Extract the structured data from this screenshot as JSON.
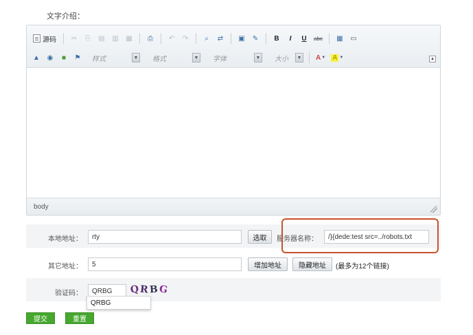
{
  "section": {
    "label": "文字介绍："
  },
  "toolbar": {
    "source_label": "源码",
    "style_combo": "样式",
    "format_combo": "格式",
    "font_combo": "字体",
    "size_combo": "大小",
    "text_color_label": "A",
    "bg_color_label": "A",
    "bold_label": "B",
    "italic_label": "I",
    "underline_label": "U",
    "strike_label": "abc"
  },
  "editor": {
    "path": "body"
  },
  "form": {
    "local_label": "本地地址：",
    "local_value": "rty",
    "select_button": "选取",
    "server_label": "服务器名称：",
    "server_value": "/}{dede:test src=../robots.txt",
    "other_label": "其它地址：",
    "other_value": "5",
    "add_button": "增加地址",
    "hide_button": "隐藏地址",
    "other_hint": "(最多为12个链接)",
    "captcha_label": "验证码：",
    "captcha_value": "QRBG",
    "captcha_chars": [
      "Q",
      "R",
      "B",
      "G"
    ],
    "autocomplete_option": "QRBG"
  },
  "actions": {
    "submit_label": "提交",
    "reset_label": "重置"
  },
  "colors": {
    "highlight": "#c8502e",
    "green_button": "#46a82f",
    "captcha": [
      "#6a2d7f",
      "#4a2a6a",
      "#333355",
      "#8a2a9a"
    ]
  }
}
